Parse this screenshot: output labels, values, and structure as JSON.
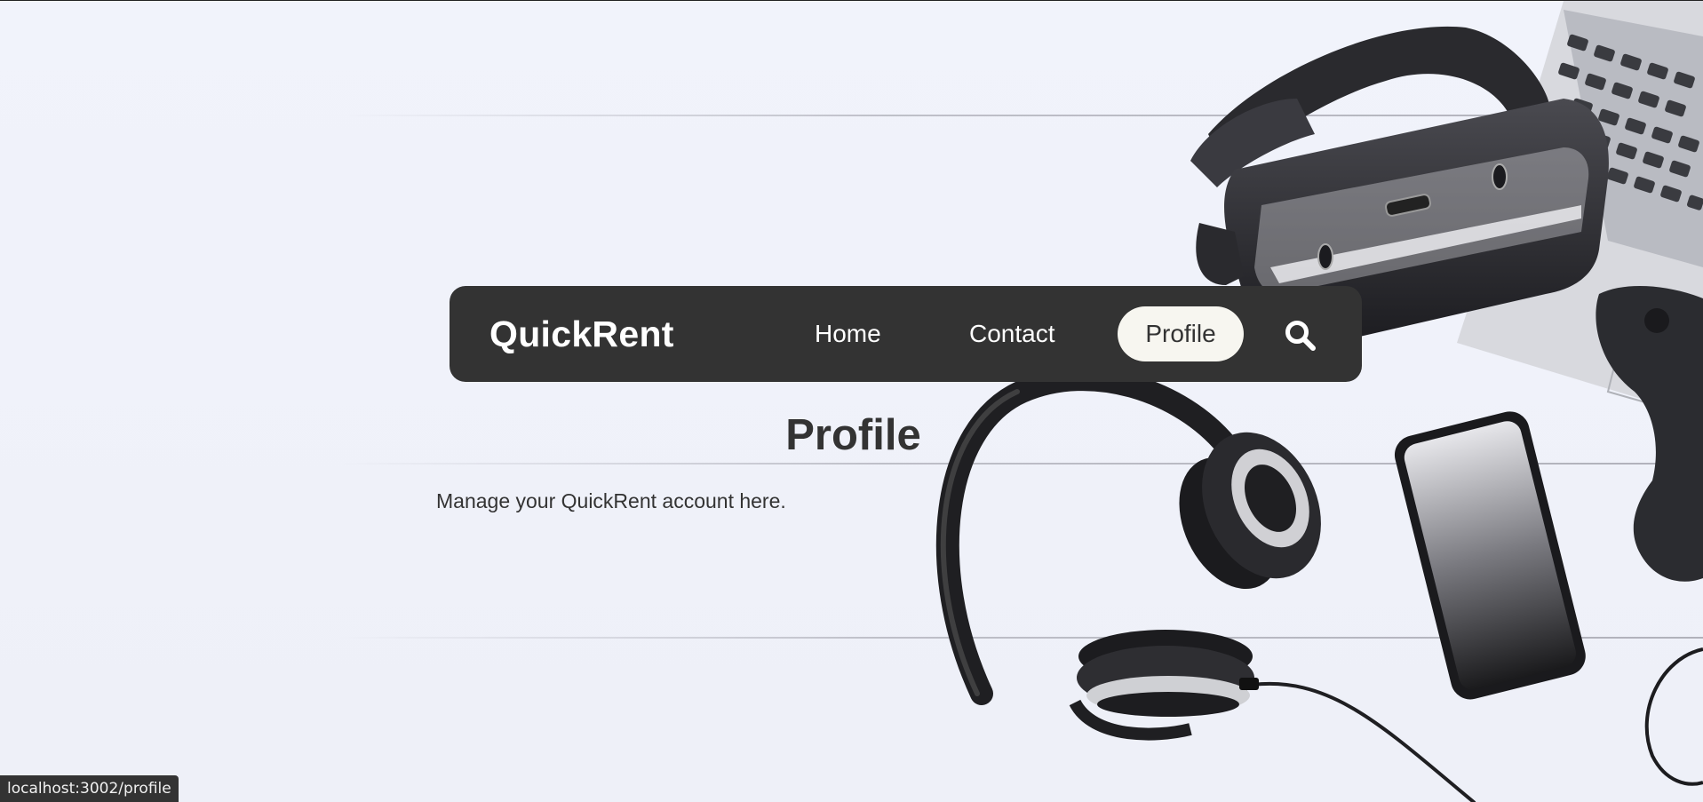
{
  "navbar": {
    "brand": "QuickRent",
    "links": [
      {
        "label": "Home"
      },
      {
        "label": "Contact"
      },
      {
        "label": "Profile",
        "active": true
      }
    ],
    "search_icon": "search-icon"
  },
  "main": {
    "title": "Profile",
    "description": "Manage your QuickRent account here."
  },
  "status_bar": {
    "url": "localhost:3002/profile"
  },
  "colors": {
    "navbar_bg": "#333333",
    "active_pill_bg": "#f7f6f0",
    "text_dark": "#333333",
    "page_bg": "#f1f3fb"
  }
}
